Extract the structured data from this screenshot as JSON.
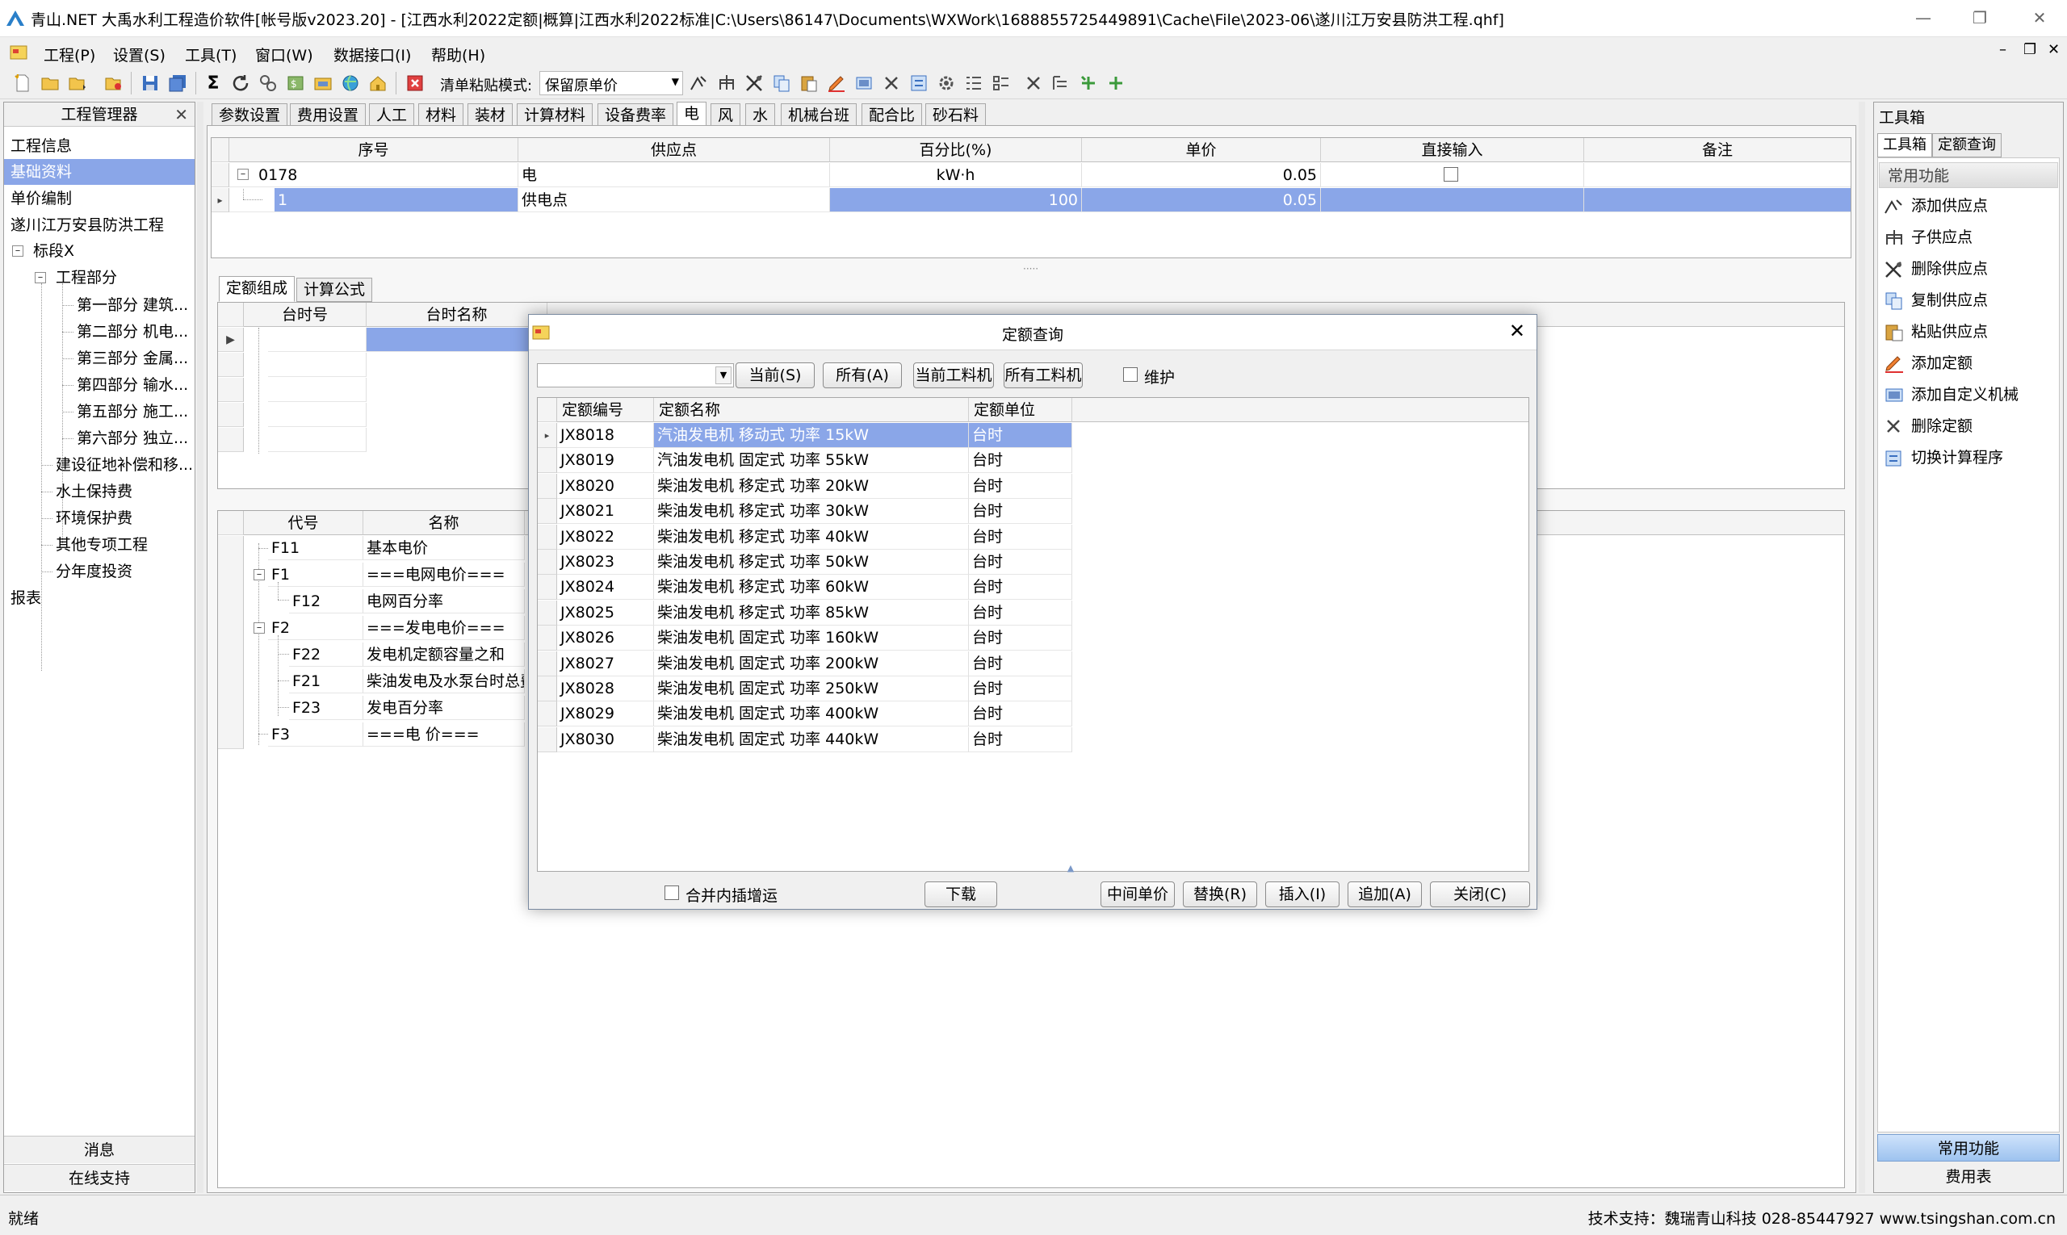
{
  "window": {
    "title": "青山.NET 大禹水利工程造价软件[帐号版v2023.20] - [江西水利2022定额|概算|江西水利2022标准|C:\\Users\\86147\\Documents\\WXWork\\1688855725449891\\Cache\\File\\2023-06\\遂川江万安县防洪工程.qhf]"
  },
  "menu": [
    "工程(P)",
    "设置(S)",
    "工具(T)",
    "窗口(W)",
    "数据接口(I)",
    "帮助(H)"
  ],
  "toolbar": {
    "paste_mode_label": "清单粘贴模式:",
    "paste_mode_value": "保留原单价"
  },
  "left_panel": {
    "title": "工程管理器",
    "items": [
      {
        "label": "工程信息"
      },
      {
        "label": "基础资料"
      },
      {
        "label": "单价编制"
      },
      {
        "label": "遂川江万安县防洪工程"
      },
      {
        "label": "标段X"
      },
      {
        "label": "工程部分"
      },
      {
        "label": "第一部分 建筑..."
      },
      {
        "label": "第二部分 机电..."
      },
      {
        "label": "第三部分 金属..."
      },
      {
        "label": "第四部分 输水..."
      },
      {
        "label": "第五部分 施工..."
      },
      {
        "label": "第六部分 独立..."
      },
      {
        "label": "建设征地补偿和移..."
      },
      {
        "label": "水土保持费"
      },
      {
        "label": "环境保护费"
      },
      {
        "label": "其他专项工程"
      },
      {
        "label": "分年度投资"
      },
      {
        "label": "报表"
      }
    ],
    "bottom_buttons": [
      "消息",
      "在线支持"
    ]
  },
  "top_tabs": [
    "参数设置",
    "费用设置",
    "人工",
    "材料",
    "装材",
    "计算材料",
    "设备费率",
    "电",
    "风",
    "水",
    "机械台班",
    "配合比",
    "砂石料"
  ],
  "supply_grid": {
    "headers": [
      "序号",
      "供应点",
      "百分比(%)",
      "单价",
      "直接输入",
      "备注"
    ],
    "rows": [
      {
        "no": "0178",
        "point": "电",
        "percent": "kW·h",
        "price": "0.05"
      },
      {
        "no": "1",
        "point": "供电点",
        "percent": "100",
        "price": "0.05"
      }
    ]
  },
  "sub_tabs": [
    "定额组成",
    "计算公式"
  ],
  "quota_grid": {
    "headers": [
      "台时号",
      "台时名称"
    ]
  },
  "formula_grid": {
    "headers": [
      "代号",
      "名称"
    ],
    "rows": [
      {
        "code": "F11",
        "name": "基本电价"
      },
      {
        "code": "F1",
        "name": "===电网电价==="
      },
      {
        "code": "F12",
        "name": "电网百分率"
      },
      {
        "code": "F2",
        "name": "===发电电价==="
      },
      {
        "code": "F22",
        "name": "发电机定额容量之和"
      },
      {
        "code": "F21",
        "name": "柴油发电及水泵台时总费"
      },
      {
        "code": "F23",
        "name": "发电百分率"
      },
      {
        "code": "F3",
        "name": "===电    价==="
      }
    ]
  },
  "right_panel": {
    "title": "工具箱",
    "tabs": [
      "工具箱",
      "定额查询"
    ],
    "section": "常用功能",
    "items": [
      "添加供应点",
      "子供应点",
      "删除供应点",
      "复制供应点",
      "粘贴供应点",
      "添加定额",
      "添加自定义机械",
      "删除定额",
      "切换计算程序"
    ],
    "bottom": [
      "常用功能",
      "费用表"
    ]
  },
  "dialog": {
    "title": "定额查询",
    "buttons_top": [
      "当前(S)",
      "所有(A)",
      "当前工料机",
      "所有工料机"
    ],
    "maintain_label": "维护",
    "headers": [
      "定额编号",
      "定额名称",
      "定额单位"
    ],
    "rows": [
      {
        "code": "JX8018",
        "name": "汽油发电机 移动式 功率 15kW",
        "unit": "台时"
      },
      {
        "code": "JX8019",
        "name": "汽油发电机 固定式 功率 55kW",
        "unit": "台时"
      },
      {
        "code": "JX8020",
        "name": "柴油发电机 移定式 功率 20kW",
        "unit": "台时"
      },
      {
        "code": "JX8021",
        "name": "柴油发电机 移定式 功率 30kW",
        "unit": "台时"
      },
      {
        "code": "JX8022",
        "name": "柴油发电机 移定式 功率 40kW",
        "unit": "台时"
      },
      {
        "code": "JX8023",
        "name": "柴油发电机 移定式 功率 50kW",
        "unit": "台时"
      },
      {
        "code": "JX8024",
        "name": "柴油发电机 移定式 功率 60kW",
        "unit": "台时"
      },
      {
        "code": "JX8025",
        "name": "柴油发电机 移定式 功率 85kW",
        "unit": "台时"
      },
      {
        "code": "JX8026",
        "name": "柴油发电机 固定式 功率 160kW",
        "unit": "台时"
      },
      {
        "code": "JX8027",
        "name": "柴油发电机 固定式 功率 200kW",
        "unit": "台时"
      },
      {
        "code": "JX8028",
        "name": "柴油发电机 固定式 功率 250kW",
        "unit": "台时"
      },
      {
        "code": "JX8029",
        "name": "柴油发电机 固定式 功率 400kW",
        "unit": "台时"
      },
      {
        "code": "JX8030",
        "name": "柴油发电机 固定式 功率 440kW",
        "unit": "台时"
      }
    ],
    "merge_label": "合并内插增运",
    "download_label": "下载",
    "buttons_bottom": [
      "中间单价",
      "替换(R)",
      "插入(I)",
      "追加(A)",
      "关闭(C)"
    ]
  },
  "status": {
    "left": "就绪",
    "right": "技术支持：魏瑞青山科技 028-85447927 www.tsingshan.com.cn"
  },
  "colors": {
    "selection": "#8aa6e8",
    "dialog_selection": "#8aa6e8"
  }
}
